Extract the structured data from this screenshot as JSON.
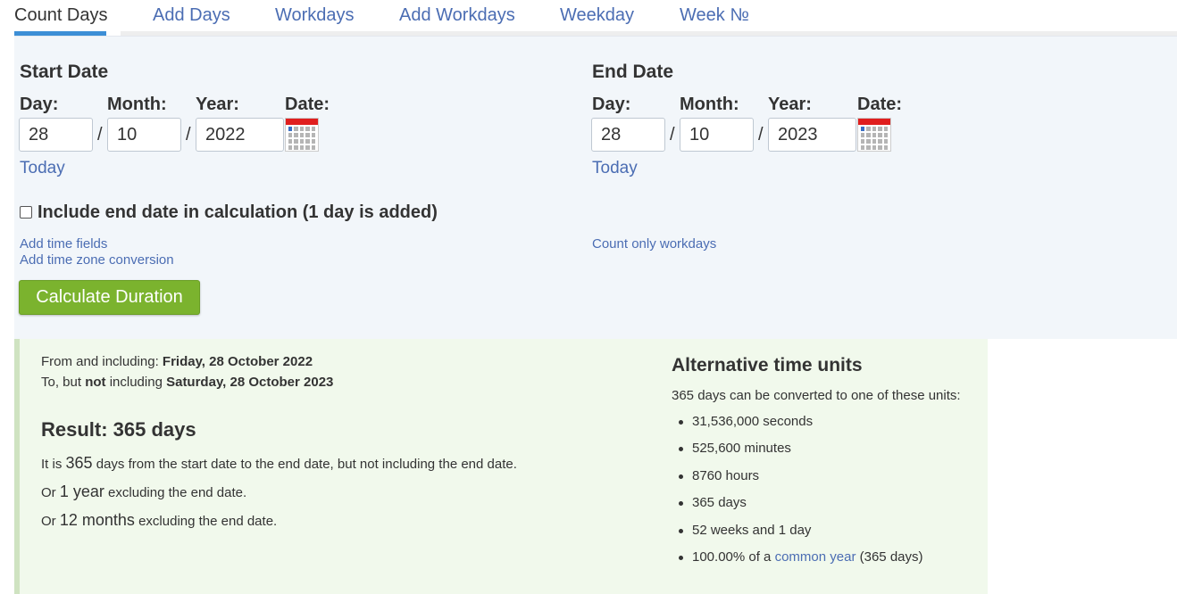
{
  "tabs": [
    {
      "label": "Count Days",
      "active": true
    },
    {
      "label": "Add Days"
    },
    {
      "label": "Workdays"
    },
    {
      "label": "Add Workdays"
    },
    {
      "label": "Weekday"
    },
    {
      "label": "Week №"
    }
  ],
  "start": {
    "title": "Start Date",
    "day_label": "Day:",
    "month_label": "Month:",
    "year_label": "Year:",
    "date_label": "Date:",
    "day": "28",
    "month": "10",
    "year": "2022",
    "separator": "/",
    "today_link": "Today"
  },
  "end": {
    "title": "End Date",
    "day_label": "Day:",
    "month_label": "Month:",
    "year_label": "Year:",
    "date_label": "Date:",
    "day": "28",
    "month": "10",
    "year": "2023",
    "separator": "/",
    "today_link": "Today"
  },
  "options": {
    "include_end_label": "Include end date in calculation (1 day is added)",
    "include_end_checked": false,
    "add_time_fields": "Add time fields",
    "add_time_zone": "Add time zone conversion",
    "count_workdays": "Count only workdays",
    "calculate_button": "Calculate Duration"
  },
  "result": {
    "from_prefix": "From and including:",
    "from_date": "Friday, 28 October 2022",
    "to_prefix_1": "To, but",
    "to_not": "not",
    "to_prefix_2": "including",
    "to_date": "Saturday, 28 October 2023",
    "title": "Result: 365 days",
    "line1_pre": "It is",
    "line1_num": "365",
    "line1_post": "days from the start date to the end date, but not including the end date.",
    "line2_pre": "Or",
    "line2_num": "1 year",
    "line2_post": "excluding the end date.",
    "line3_pre": "Or",
    "line3_num": "12 months",
    "line3_post": "excluding the end date."
  },
  "alternative": {
    "title": "Alternative time units",
    "intro": "365 days can be converted to one of these units:",
    "units": [
      "31,536,000 seconds",
      "525,600 minutes",
      "8760 hours",
      "365 days",
      "52 weeks and 1 day"
    ],
    "last_pre": "100.00% of a",
    "last_link": "common year",
    "last_post": "(365 days)"
  },
  "colors": {
    "link": "#4b6db3",
    "tab_active_underline": "#3d8fd6",
    "button": "#7bb32e",
    "form_bg": "#f2f6fa",
    "result_bg": "#f1f9ec",
    "calendar_red": "#e01e1e"
  }
}
